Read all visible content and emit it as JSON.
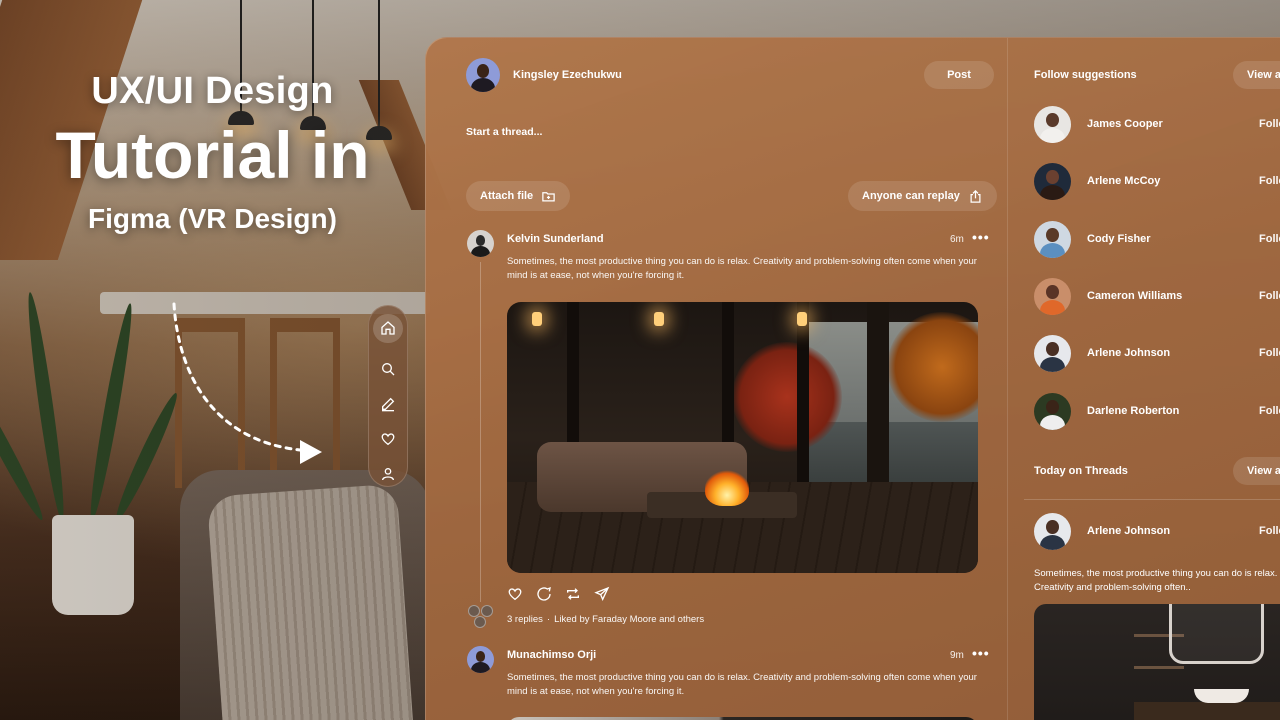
{
  "headline": {
    "line1": "UX/UI Design",
    "line2": "Tutorial in",
    "line3": "Figma (VR Design)"
  },
  "composer": {
    "user_name": "Kingsley Ezechukwu",
    "post_label": "Post",
    "placeholder": "Start a thread...",
    "attach_label": "Attach file",
    "reply_label": "Anyone can replay"
  },
  "posts": [
    {
      "author": "Kelvin Sunderland",
      "time": "6m",
      "text": "Sometimes, the most productive thing you can do is relax. Creativity and problem-solving often come when your mind is at ease, not when you're forcing it.",
      "replies": "3 replies",
      "likes": "Liked by Faraday Moore and others"
    },
    {
      "author": "Munachimso Orji",
      "time": "9m",
      "text": "Sometimes, the most productive thing you can do is relax. Creativity and problem-solving often come when your mind is at ease, not when you're forcing it."
    }
  ],
  "sidebar": {
    "follow_title": "Follow suggestions",
    "view_all": "View all",
    "follow_label": "Follow",
    "suggestions": [
      {
        "name": "James Cooper"
      },
      {
        "name": "Arlene McCoy"
      },
      {
        "name": "Cody Fisher"
      },
      {
        "name": "Cameron Williams"
      },
      {
        "name": "Arlene Johnson"
      },
      {
        "name": "Darlene Roberton"
      }
    ],
    "today_title": "Today on Threads",
    "today_user": "Arlene Johnson",
    "today_text": "Sometimes, the most productive thing you can do is relax. Creativity and problem-solving often.."
  },
  "dock": {
    "items": [
      "home-icon",
      "search-icon",
      "edit-icon",
      "heart-icon",
      "user-icon"
    ]
  },
  "colors": {
    "panel": "#a8704a",
    "accent_pill": "rgba(255,255,255,0.12)"
  }
}
